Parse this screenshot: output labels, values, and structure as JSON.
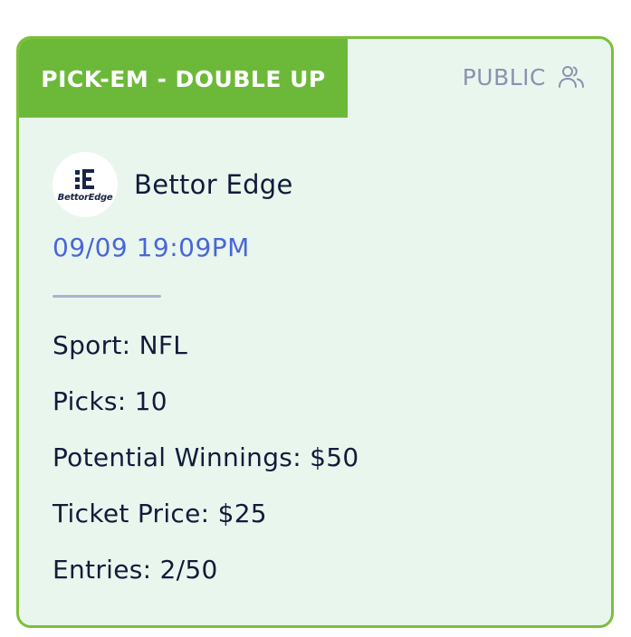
{
  "card": {
    "game_type": "PICK-EM - DOUBLE UP",
    "visibility_label": "PUBLIC",
    "visibility_icon": "users-icon",
    "org": {
      "logo_text": "BettorEdge",
      "name": "Bettor Edge"
    },
    "datetime": "09/09 19:09PM",
    "details": [
      {
        "label": "Sport",
        "value": "NFL",
        "text": "Sport: NFL"
      },
      {
        "label": "Picks",
        "value": "10",
        "text": "Picks: 10"
      },
      {
        "label": "Potential Winnings",
        "value": "$50",
        "text": "Potential Winnings: $50"
      },
      {
        "label": "Ticket Price",
        "value": "$25",
        "text": "Ticket Price: $25"
      },
      {
        "label": "Entries",
        "value": "2/50",
        "text": "Entries: 2/50"
      }
    ]
  },
  "colors": {
    "accent_green": "#6cb93a",
    "card_background": "#e9f6ee",
    "date_blue": "#4a66d6",
    "muted_text": "#8893b0",
    "primary_text": "#111c3a"
  }
}
